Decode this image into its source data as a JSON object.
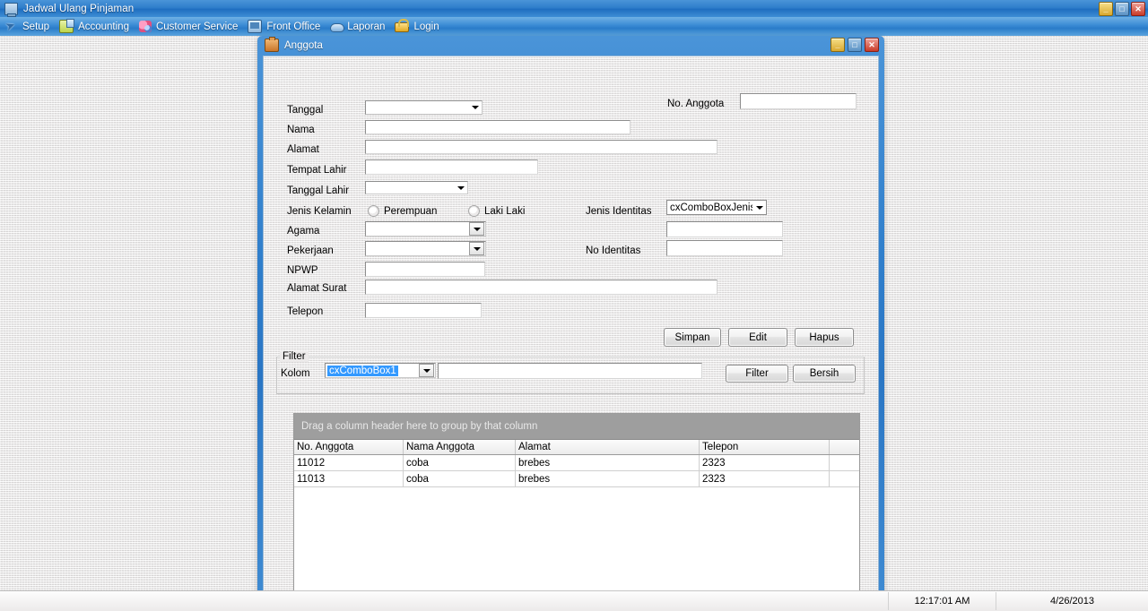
{
  "app": {
    "title": "Jadwal Ulang Pinjaman",
    "icon": "computer-icon",
    "window_buttons": [
      {
        "name": "minimize",
        "glyph": "_"
      },
      {
        "name": "maximize",
        "glyph": "□"
      },
      {
        "name": "close",
        "glyph": "✕"
      }
    ]
  },
  "menubar": {
    "items": [
      {
        "label": "Setup",
        "icon": "wrench-icon"
      },
      {
        "label": "Accounting",
        "icon": "ledger-icon"
      },
      {
        "label": "Customer Service",
        "icon": "people-icon"
      },
      {
        "label": "Front Office",
        "icon": "monitor-icon"
      },
      {
        "label": "Laporan",
        "icon": "report-icon"
      },
      {
        "label": "Login",
        "icon": "lock-icon"
      }
    ]
  },
  "dialog": {
    "title": "Anggota",
    "icon": "briefcase-icon",
    "window_buttons": [
      {
        "name": "minimize",
        "glyph": "_"
      },
      {
        "name": "maximize",
        "glyph": "□"
      },
      {
        "name": "close",
        "glyph": "✕"
      }
    ],
    "form": {
      "labels": {
        "tanggal": "Tanggal",
        "nama": "Nama",
        "alamat": "Alamat",
        "tempat_lahir": "Tempat Lahir",
        "tanggal_lahir": "Tanggal Lahir",
        "jenis_kelamin": "Jenis Kelamin",
        "agama": "Agama",
        "pekerjaan": "Pekerjaan",
        "npwp": "NPWP",
        "alamat_surat": "Alamat Surat",
        "telepon": "Telepon",
        "no_anggota": "No. Anggota",
        "jenis_identitas": "Jenis Identitas",
        "no_identitas": "No Identitas"
      },
      "values": {
        "tanggal": "",
        "nama": "",
        "alamat": "",
        "tempat_lahir": "",
        "tanggal_lahir": "",
        "agama": "",
        "pekerjaan": "",
        "npwp": "",
        "alamat_surat": "",
        "telepon": "",
        "no_anggota": "",
        "jenis_identitas": "cxComboBoxJenisId",
        "identitas_extra": "",
        "no_identitas": ""
      },
      "radios": {
        "perempuan": "Perempuan",
        "laki_laki": "Laki Laki"
      }
    },
    "actions": {
      "simpan": "Simpan",
      "edit": "Edit",
      "hapus": "Hapus"
    },
    "filter": {
      "legend": "Filter",
      "kolom_label": "Kolom",
      "kolom_value": "cxComboBox1",
      "text_value": "",
      "filter_button": "Filter",
      "bersih_button": "Bersih"
    },
    "grid": {
      "group_hint": "Drag a column header here to group by that column",
      "columns": [
        "No. Anggota",
        "Nama Anggota",
        "Alamat",
        "Telepon"
      ],
      "rows": [
        [
          "11012",
          "coba",
          "brebes",
          "2323"
        ],
        [
          "11013",
          "coba",
          "brebes",
          "2323"
        ]
      ]
    }
  },
  "statusbar": {
    "time": "12:17:01 AM",
    "date": "4/26/2013"
  },
  "colors": {
    "titlebar_blue": "#2f7ecb",
    "selection_blue": "#3399ff",
    "grid_groupbar": "#9e9e9e",
    "desktop": "#eceaea"
  }
}
